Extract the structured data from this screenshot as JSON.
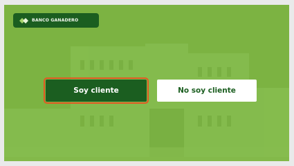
{
  "brand": {
    "name": "BANCO GANADERO",
    "logo_icon": "bank-ganadero-logo-icon",
    "primary_color": "#1b5e20",
    "background_color": "#7cb342",
    "focus_outline_color": "#e25822"
  },
  "buttons": {
    "client_label": "Soy cliente",
    "nonclient_label": "No soy cliente"
  }
}
